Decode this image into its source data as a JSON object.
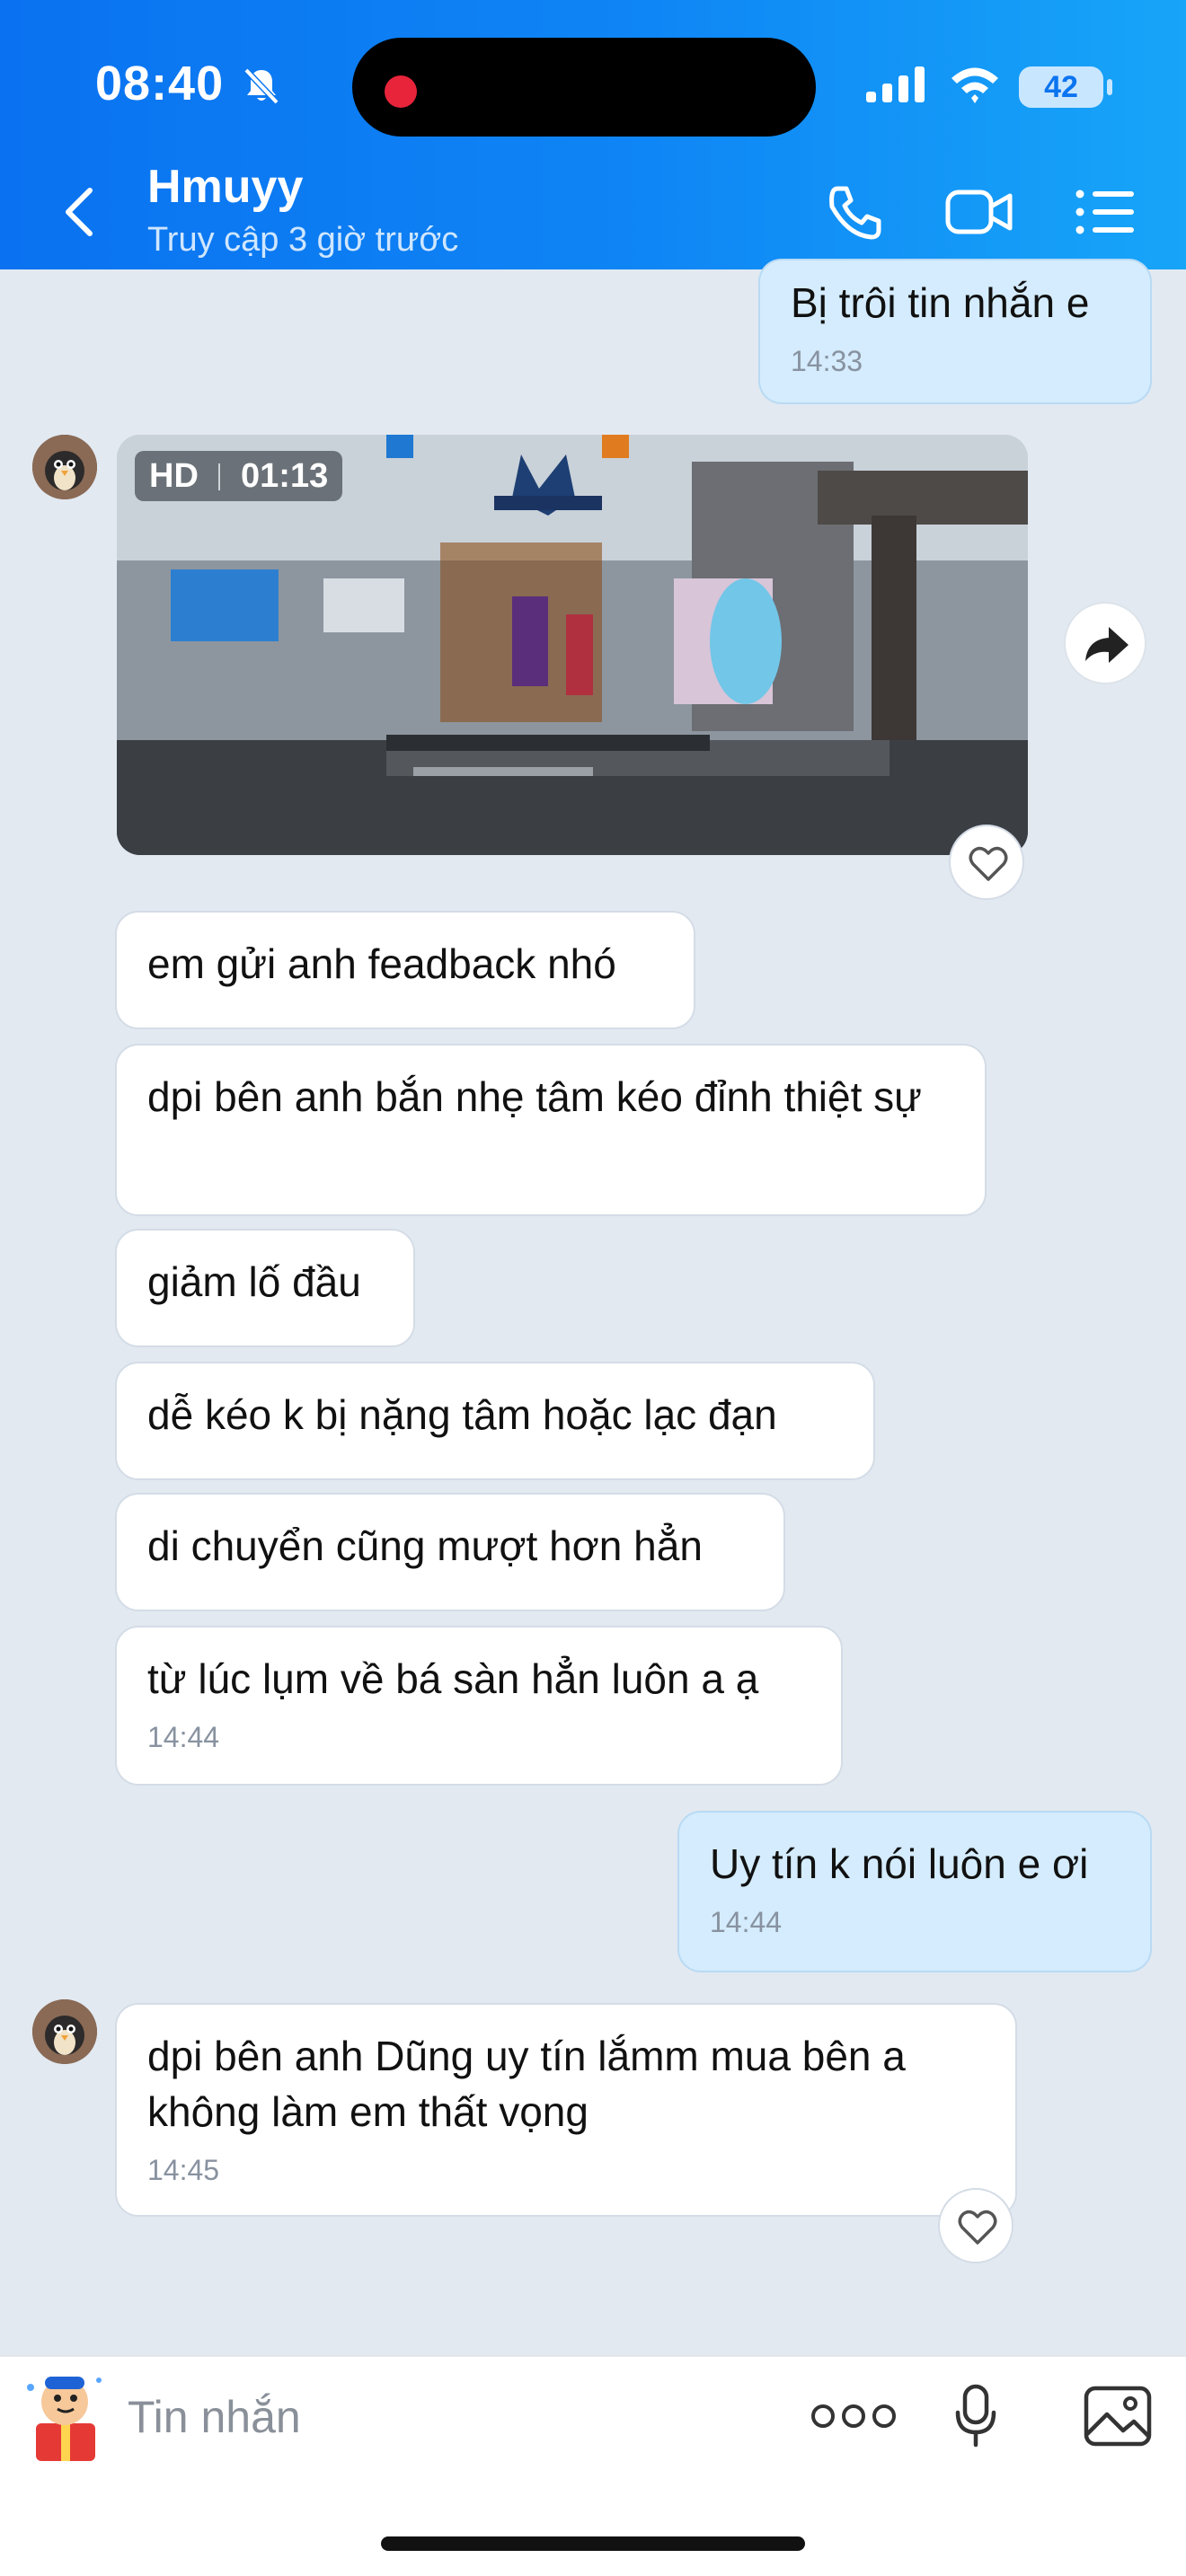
{
  "status_bar": {
    "time": "08:40",
    "battery": "42"
  },
  "header": {
    "contact_name": "Hmuyy",
    "contact_status": "Truy cập 3 giờ trước"
  },
  "video": {
    "quality": "HD",
    "duration": "01:13"
  },
  "messages": [
    {
      "direction": "out",
      "text": "Bị trôi tin nhắn e",
      "time": "14:33"
    },
    {
      "direction": "in",
      "text": "em gửi anh feadback nhó",
      "time": ""
    },
    {
      "direction": "in",
      "text": "dpi bên anh bắn nhẹ tâm kéo đỉnh thiệt sự",
      "time": ""
    },
    {
      "direction": "in",
      "text": "giảm lố đầu",
      "time": ""
    },
    {
      "direction": "in",
      "text": "dễ kéo k bị nặng tâm hoặc lạc đạn",
      "time": ""
    },
    {
      "direction": "in",
      "text": "di chuyển cũng mượt hơn hẳn",
      "time": ""
    },
    {
      "direction": "in",
      "text": "từ lúc lụm về bá sàn hẳn luôn a ạ",
      "time": "14:44"
    },
    {
      "direction": "out",
      "text": "Uy tín k nói luôn e ơi",
      "time": "14:44"
    },
    {
      "direction": "in",
      "text": "dpi bên anh Dũng uy tín lắmm mua bên a không làm em thất vọng",
      "time": "14:45"
    }
  ],
  "input": {
    "placeholder": "Tin nhắn"
  },
  "colors": {
    "header_start": "#0a72f0",
    "header_end": "#17a5f8",
    "chat_bg": "#e2e9f1",
    "outgoing_bubble": "#d4ecfd",
    "incoming_bubble": "#ffffff"
  },
  "icons": [
    "bell-off-icon",
    "signal-icon",
    "wifi-icon",
    "back-icon",
    "phone-icon",
    "video-camera-icon",
    "list-menu-icon",
    "share-icon",
    "heart-icon",
    "more-dots-icon",
    "microphone-icon",
    "image-icon"
  ]
}
